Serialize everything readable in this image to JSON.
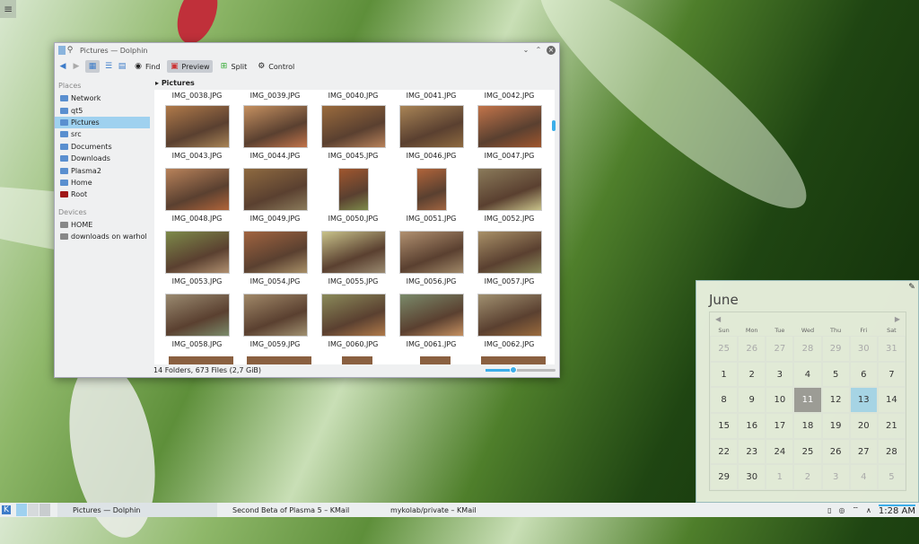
{
  "desktop": {
    "menu_icon": "hamburger-icon"
  },
  "dolphin": {
    "title": "Pictures — Dolphin",
    "toolbar": {
      "find": "Find",
      "preview": "Preview",
      "split": "Split",
      "control": "Control"
    },
    "places_header": "Places",
    "places": [
      "Network",
      "qt5",
      "Pictures",
      "src",
      "Documents",
      "Downloads",
      "Plasma2",
      "Home",
      "Root"
    ],
    "devices_header": "Devices",
    "devices": [
      "HOME",
      "downloads on warhol"
    ],
    "breadcrumb": "Pictures",
    "top_labels": [
      "IMG_0038.JPG",
      "IMG_0039.JPG",
      "IMG_0040.JPG",
      "IMG_0041.JPG",
      "IMG_0042.JPG"
    ],
    "files": [
      "IMG_0043.JPG",
      "IMG_0044.JPG",
      "IMG_0045.JPG",
      "IMG_0046.JPG",
      "IMG_0047.JPG",
      "IMG_0048.JPG",
      "IMG_0049.JPG",
      "IMG_0050.JPG",
      "IMG_0051.JPG",
      "IMG_0052.JPG",
      "IMG_0053.JPG",
      "IMG_0054.JPG",
      "IMG_0055.JPG",
      "IMG_0056.JPG",
      "IMG_0057.JPG",
      "IMG_0058.JPG",
      "IMG_0059.JPG",
      "IMG_0060.JPG",
      "IMG_0061.JPG",
      "IMG_0062.JPG"
    ],
    "status": "14 Folders, 673 Files (2,7 GiB)",
    "zoom_fraction": 0.4
  },
  "calendar": {
    "month": "June",
    "weekdays": [
      "Sun",
      "Mon",
      "Tue",
      "Wed",
      "Thu",
      "Fri",
      "Sat"
    ],
    "days": [
      "25",
      "26",
      "27",
      "28",
      "29",
      "30",
      "31",
      "1",
      "2",
      "3",
      "4",
      "5",
      "6",
      "7",
      "8",
      "9",
      "10",
      "11",
      "12",
      "13",
      "14",
      "15",
      "16",
      "17",
      "18",
      "19",
      "20",
      "21",
      "22",
      "23",
      "24",
      "25",
      "26",
      "27",
      "28",
      "29",
      "30",
      "1",
      "2",
      "3",
      "4",
      "5"
    ],
    "today": "11",
    "selected": "13"
  },
  "taskbar": {
    "tasks": [
      "Pictures — Dolphin",
      "Second Beta of Plasma 5 – KMail",
      "mykolab/private – KMail"
    ],
    "clock": "1:28 AM"
  },
  "colors": {
    "accent": "#3daee9"
  }
}
